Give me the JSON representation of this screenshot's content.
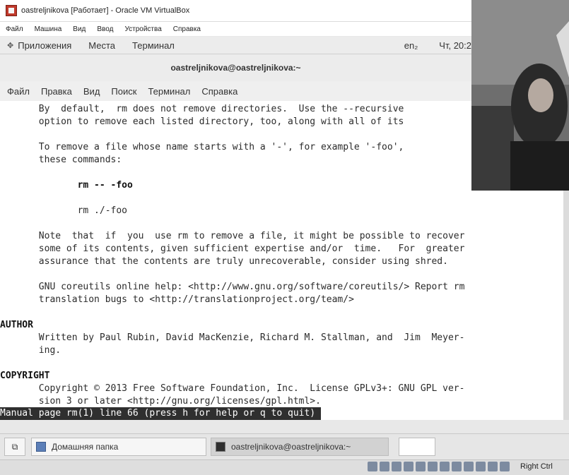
{
  "window": {
    "title": "oastreljnikova [Работает] - Oracle VM VirtualBox"
  },
  "vbox_menu": [
    "Файл",
    "Машина",
    "Вид",
    "Ввод",
    "Устройства",
    "Справка"
  ],
  "gnome_panel": {
    "apps": "Приложения",
    "places": "Места",
    "terminal": "Терминал",
    "lang": "en₂",
    "clock": "Чт, 20:2"
  },
  "terminal": {
    "title": "oastreljnikova@oastreljnikova:~",
    "menu": [
      "Файл",
      "Правка",
      "Вид",
      "Поиск",
      "Терминал",
      "Справка"
    ],
    "lines": [
      "       By  default,  rm does not remove directories.  Use the --recursive",
      "       option to remove each listed directory, too, along with all of its",
      "",
      "       To remove a file whose name starts with a '-', for example '-foo',",
      "       these commands:",
      "",
      "              rm -- -foo",
      "",
      "              rm ./-foo",
      "",
      "       Note  that  if  you  use rm to remove a file, it might be possible to recover",
      "       some of its contents, given sufficient expertise and/or  time.   For  greater",
      "       assurance that the contents are truly unrecoverable, consider using shred.",
      "",
      "       GNU coreutils online help: <http://www.gnu.org/software/coreutils/> Report rm",
      "       translation bugs to <http://translationproject.org/team/>",
      "",
      "AUTHOR",
      "       Written by Paul Rubin, David MacKenzie, Richard M. Stallman, and  Jim  Meyer-",
      "       ing.",
      "",
      "COPYRIGHT",
      "       Copyright © 2013 Free Software Foundation, Inc.  License GPLv3+: GNU GPL ver-",
      "       sion 3 or later <http://gnu.org/licenses/gpl.html>."
    ],
    "status": "Manual page rm(1) line 66 (press h for help or q to quit)"
  },
  "taskbar": {
    "home_folder": "Домашняя папка",
    "terminal_window": "oastreljnikova@oastreljnikova:~"
  },
  "vbox_status": {
    "host_key": "Right Ctrl"
  },
  "colors": {
    "status_bg": "#2f2f2f",
    "terminal_bg": "#ffffff"
  }
}
